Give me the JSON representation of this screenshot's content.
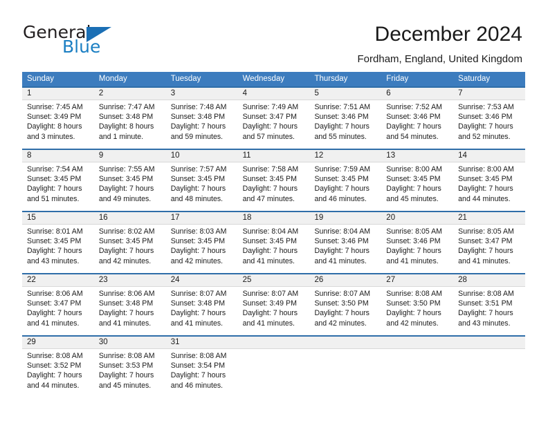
{
  "brand": {
    "logo_part1": "General",
    "logo_part2": "Blue",
    "triangle_icon": "triangle-icon",
    "accent_color": "#1b7fc3"
  },
  "header": {
    "title": "December 2024",
    "location": "Fordham, England, United Kingdom"
  },
  "calendar": {
    "header_color": "#3c7cbe",
    "week_divider_color": "#2e6da8",
    "date_band_color": "#f0f0f0",
    "day_names": [
      "Sunday",
      "Monday",
      "Tuesday",
      "Wednesday",
      "Thursday",
      "Friday",
      "Saturday"
    ],
    "weeks": [
      [
        {
          "date": "1",
          "lines": [
            "Sunrise: 7:45 AM",
            "Sunset: 3:49 PM",
            "Daylight: 8 hours",
            "and 3 minutes."
          ]
        },
        {
          "date": "2",
          "lines": [
            "Sunrise: 7:47 AM",
            "Sunset: 3:48 PM",
            "Daylight: 8 hours",
            "and 1 minute."
          ]
        },
        {
          "date": "3",
          "lines": [
            "Sunrise: 7:48 AM",
            "Sunset: 3:48 PM",
            "Daylight: 7 hours",
            "and 59 minutes."
          ]
        },
        {
          "date": "4",
          "lines": [
            "Sunrise: 7:49 AM",
            "Sunset: 3:47 PM",
            "Daylight: 7 hours",
            "and 57 minutes."
          ]
        },
        {
          "date": "5",
          "lines": [
            "Sunrise: 7:51 AM",
            "Sunset: 3:46 PM",
            "Daylight: 7 hours",
            "and 55 minutes."
          ]
        },
        {
          "date": "6",
          "lines": [
            "Sunrise: 7:52 AM",
            "Sunset: 3:46 PM",
            "Daylight: 7 hours",
            "and 54 minutes."
          ]
        },
        {
          "date": "7",
          "lines": [
            "Sunrise: 7:53 AM",
            "Sunset: 3:46 PM",
            "Daylight: 7 hours",
            "and 52 minutes."
          ]
        }
      ],
      [
        {
          "date": "8",
          "lines": [
            "Sunrise: 7:54 AM",
            "Sunset: 3:45 PM",
            "Daylight: 7 hours",
            "and 51 minutes."
          ]
        },
        {
          "date": "9",
          "lines": [
            "Sunrise: 7:55 AM",
            "Sunset: 3:45 PM",
            "Daylight: 7 hours",
            "and 49 minutes."
          ]
        },
        {
          "date": "10",
          "lines": [
            "Sunrise: 7:57 AM",
            "Sunset: 3:45 PM",
            "Daylight: 7 hours",
            "and 48 minutes."
          ]
        },
        {
          "date": "11",
          "lines": [
            "Sunrise: 7:58 AM",
            "Sunset: 3:45 PM",
            "Daylight: 7 hours",
            "and 47 minutes."
          ]
        },
        {
          "date": "12",
          "lines": [
            "Sunrise: 7:59 AM",
            "Sunset: 3:45 PM",
            "Daylight: 7 hours",
            "and 46 minutes."
          ]
        },
        {
          "date": "13",
          "lines": [
            "Sunrise: 8:00 AM",
            "Sunset: 3:45 PM",
            "Daylight: 7 hours",
            "and 45 minutes."
          ]
        },
        {
          "date": "14",
          "lines": [
            "Sunrise: 8:00 AM",
            "Sunset: 3:45 PM",
            "Daylight: 7 hours",
            "and 44 minutes."
          ]
        }
      ],
      [
        {
          "date": "15",
          "lines": [
            "Sunrise: 8:01 AM",
            "Sunset: 3:45 PM",
            "Daylight: 7 hours",
            "and 43 minutes."
          ]
        },
        {
          "date": "16",
          "lines": [
            "Sunrise: 8:02 AM",
            "Sunset: 3:45 PM",
            "Daylight: 7 hours",
            "and 42 minutes."
          ]
        },
        {
          "date": "17",
          "lines": [
            "Sunrise: 8:03 AM",
            "Sunset: 3:45 PM",
            "Daylight: 7 hours",
            "and 42 minutes."
          ]
        },
        {
          "date": "18",
          "lines": [
            "Sunrise: 8:04 AM",
            "Sunset: 3:45 PM",
            "Daylight: 7 hours",
            "and 41 minutes."
          ]
        },
        {
          "date": "19",
          "lines": [
            "Sunrise: 8:04 AM",
            "Sunset: 3:46 PM",
            "Daylight: 7 hours",
            "and 41 minutes."
          ]
        },
        {
          "date": "20",
          "lines": [
            "Sunrise: 8:05 AM",
            "Sunset: 3:46 PM",
            "Daylight: 7 hours",
            "and 41 minutes."
          ]
        },
        {
          "date": "21",
          "lines": [
            "Sunrise: 8:05 AM",
            "Sunset: 3:47 PM",
            "Daylight: 7 hours",
            "and 41 minutes."
          ]
        }
      ],
      [
        {
          "date": "22",
          "lines": [
            "Sunrise: 8:06 AM",
            "Sunset: 3:47 PM",
            "Daylight: 7 hours",
            "and 41 minutes."
          ]
        },
        {
          "date": "23",
          "lines": [
            "Sunrise: 8:06 AM",
            "Sunset: 3:48 PM",
            "Daylight: 7 hours",
            "and 41 minutes."
          ]
        },
        {
          "date": "24",
          "lines": [
            "Sunrise: 8:07 AM",
            "Sunset: 3:48 PM",
            "Daylight: 7 hours",
            "and 41 minutes."
          ]
        },
        {
          "date": "25",
          "lines": [
            "Sunrise: 8:07 AM",
            "Sunset: 3:49 PM",
            "Daylight: 7 hours",
            "and 41 minutes."
          ]
        },
        {
          "date": "26",
          "lines": [
            "Sunrise: 8:07 AM",
            "Sunset: 3:50 PM",
            "Daylight: 7 hours",
            "and 42 minutes."
          ]
        },
        {
          "date": "27",
          "lines": [
            "Sunrise: 8:08 AM",
            "Sunset: 3:50 PM",
            "Daylight: 7 hours",
            "and 42 minutes."
          ]
        },
        {
          "date": "28",
          "lines": [
            "Sunrise: 8:08 AM",
            "Sunset: 3:51 PM",
            "Daylight: 7 hours",
            "and 43 minutes."
          ]
        }
      ],
      [
        {
          "date": "29",
          "lines": [
            "Sunrise: 8:08 AM",
            "Sunset: 3:52 PM",
            "Daylight: 7 hours",
            "and 44 minutes."
          ]
        },
        {
          "date": "30",
          "lines": [
            "Sunrise: 8:08 AM",
            "Sunset: 3:53 PM",
            "Daylight: 7 hours",
            "and 45 minutes."
          ]
        },
        {
          "date": "31",
          "lines": [
            "Sunrise: 8:08 AM",
            "Sunset: 3:54 PM",
            "Daylight: 7 hours",
            "and 46 minutes."
          ]
        },
        {
          "date": "",
          "lines": []
        },
        {
          "date": "",
          "lines": []
        },
        {
          "date": "",
          "lines": []
        },
        {
          "date": "",
          "lines": []
        }
      ]
    ]
  }
}
